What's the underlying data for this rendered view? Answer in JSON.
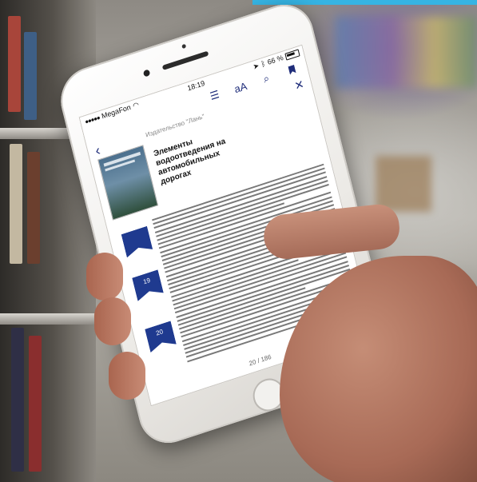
{
  "scene": {
    "description_colors": {
      "banner": "#36b4e3",
      "accent": "#1f2d7a",
      "marker": "#1f3a8f"
    }
  },
  "status_bar": {
    "signal": "●●●●●",
    "carrier": "MegaFon",
    "wifi_icon": "wifi-icon",
    "time": "18:19",
    "battery_text": "66 %",
    "icons": [
      "location-icon",
      "bluetooth-icon",
      "battery-icon"
    ]
  },
  "toolbar": {
    "icons": [
      "list-icon",
      "text-size-icon",
      "search-icon",
      "bookmark-icon"
    ],
    "text_size_label": "aA"
  },
  "book": {
    "publisher": "Издательство \"Лань\"",
    "title": "Элементы водоотведения на автомобильных дорогах"
  },
  "page_markers": [
    "",
    "19",
    "20"
  ],
  "pagination": {
    "current": "20",
    "separator": "/",
    "total": "186"
  }
}
